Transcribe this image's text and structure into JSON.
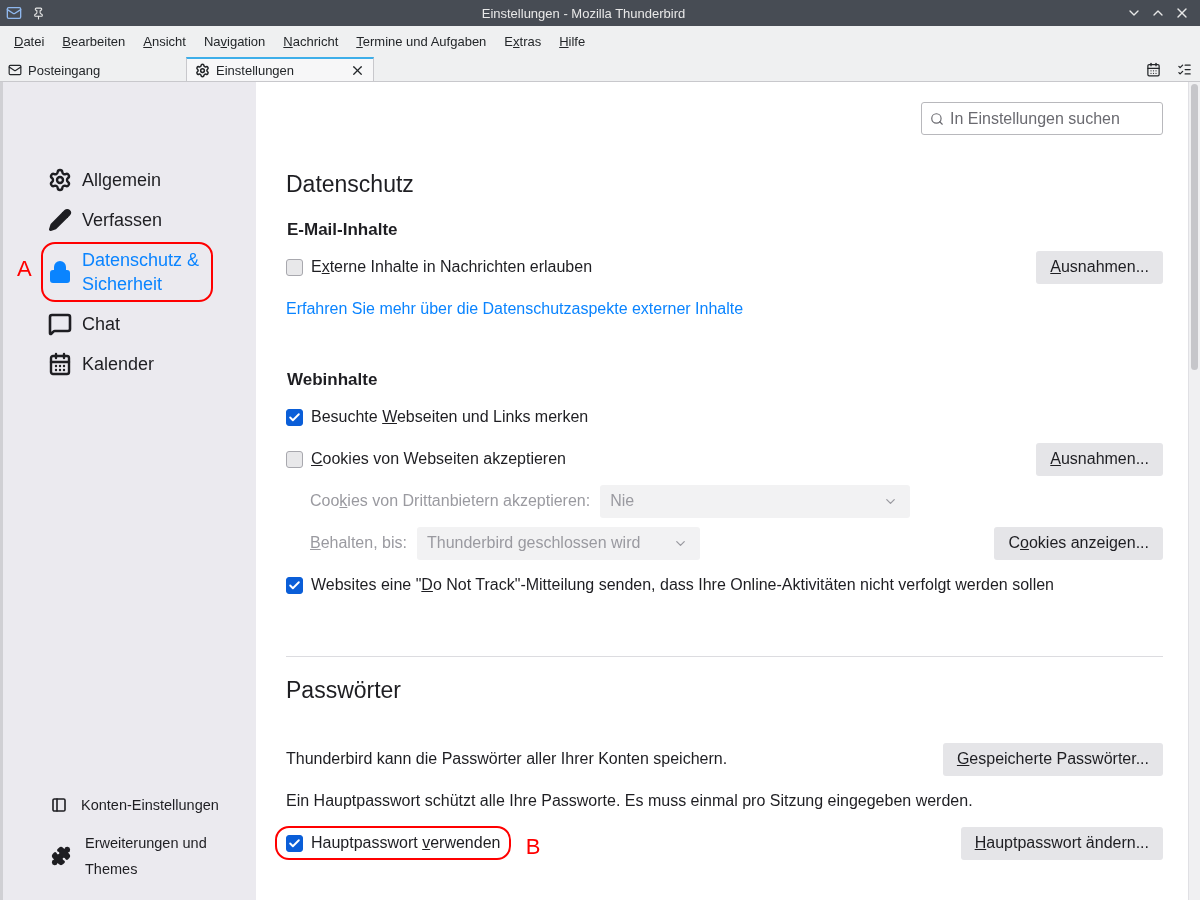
{
  "window": {
    "title": "Einstellungen - Mozilla Thunderbird"
  },
  "menu": [
    {
      "key": "D",
      "post": "atei"
    },
    {
      "key": "B",
      "post": "earbeiten"
    },
    {
      "key": "A",
      "post": "nsicht"
    },
    {
      "pre": "Na",
      "key": "v",
      "post": "igation"
    },
    {
      "key": "N",
      "post": "achricht"
    },
    {
      "key": "T",
      "post": "ermine und Aufgaben"
    },
    {
      "pre": "E",
      "key": "x",
      "post": "tras"
    },
    {
      "key": "H",
      "post": "ilfe"
    }
  ],
  "tabs": [
    {
      "label": "Posteingang",
      "kind": "mail",
      "selected": false
    },
    {
      "label": "Einstellungen",
      "kind": "settings",
      "selected": true
    }
  ],
  "sidebar": {
    "items": [
      {
        "label": "Allgemein",
        "kind": "general",
        "selected": false
      },
      {
        "label": "Verfassen",
        "kind": "compose",
        "selected": false
      },
      {
        "label": "Datenschutz & Sicherheit",
        "kind": "privacy",
        "selected": true,
        "annotation": "A"
      },
      {
        "label": "Chat",
        "kind": "chat",
        "selected": false
      },
      {
        "label": "Kalender",
        "kind": "calendar",
        "selected": false
      }
    ],
    "footer": [
      {
        "label": "Konten-Einstellungen",
        "kind": "accounts"
      },
      {
        "label": "Erweiterungen und Themes",
        "kind": "addons"
      }
    ]
  },
  "search": {
    "placeholder": "In Einstellungen suchen"
  },
  "privacy": {
    "title": "Datenschutz",
    "groups": [
      {
        "title": "E-Mail-Inhalte",
        "rows": [
          {
            "kind": "checkbox",
            "label": {
              "pre": "E",
              "key": "x",
              "post": "terne Inhalte in Nachrichten erlauben"
            },
            "checked": false,
            "button": {
              "key": "A",
              "post": "usnahmen..."
            }
          },
          {
            "kind": "link",
            "text": "Erfahren Sie mehr über die Datenschutzaspekte externer Inhalte"
          }
        ]
      },
      {
        "title": "Webinhalte",
        "rows": [
          {
            "kind": "checkbox",
            "label": {
              "pre": "Besuchte ",
              "key": "W",
              "post": "ebseiten und Links merken"
            },
            "checked": true
          },
          {
            "kind": "checkbox",
            "label": {
              "key": "C",
              "post": "ookies von Webseiten akzeptieren"
            },
            "checked": false,
            "button": {
              "key": "A",
              "post": "usnahmen..."
            }
          },
          {
            "kind": "select",
            "label": {
              "pre": "Coo",
              "key": "k",
              "post": "ies von Drittanbietern akzeptieren:"
            },
            "value": "Nie",
            "disabled": true,
            "wide": true
          },
          {
            "kind": "select",
            "label": {
              "key": "B",
              "post": "ehalten, bis:"
            },
            "value": "Thunderbird geschlossen wird",
            "disabled": true,
            "wide": false,
            "button": {
              "pre": "C",
              "key": "o",
              "post": "okies anzeigen..."
            }
          },
          {
            "kind": "checkbox",
            "label": {
              "pre": "Websites eine \"",
              "key": "D",
              "post": "o Not Track\"-Mitteilung senden, dass Ihre Online-Aktivitäten nicht verfolgt werden sollen"
            },
            "checked": true
          }
        ]
      }
    ]
  },
  "passwords": {
    "title": "Passwörter",
    "rows": [
      {
        "kind": "text",
        "text": "Thunderbird kann die Passwörter aller Ihrer Konten speichern.",
        "button": {
          "key": "G",
          "post": "espeicherte Passwörter..."
        }
      },
      {
        "kind": "text",
        "text": "Ein Hauptpasswort schützt alle Ihre Passworte. Es muss einmal pro Sitzung eingegeben werden."
      },
      {
        "kind": "checkbox",
        "label": {
          "pre": "Hauptpasswort ",
          "key": "v",
          "post": "erwenden"
        },
        "checked": true,
        "annotation": "B",
        "button": {
          "key": "H",
          "post": "auptpasswort ändern..."
        }
      }
    ]
  }
}
